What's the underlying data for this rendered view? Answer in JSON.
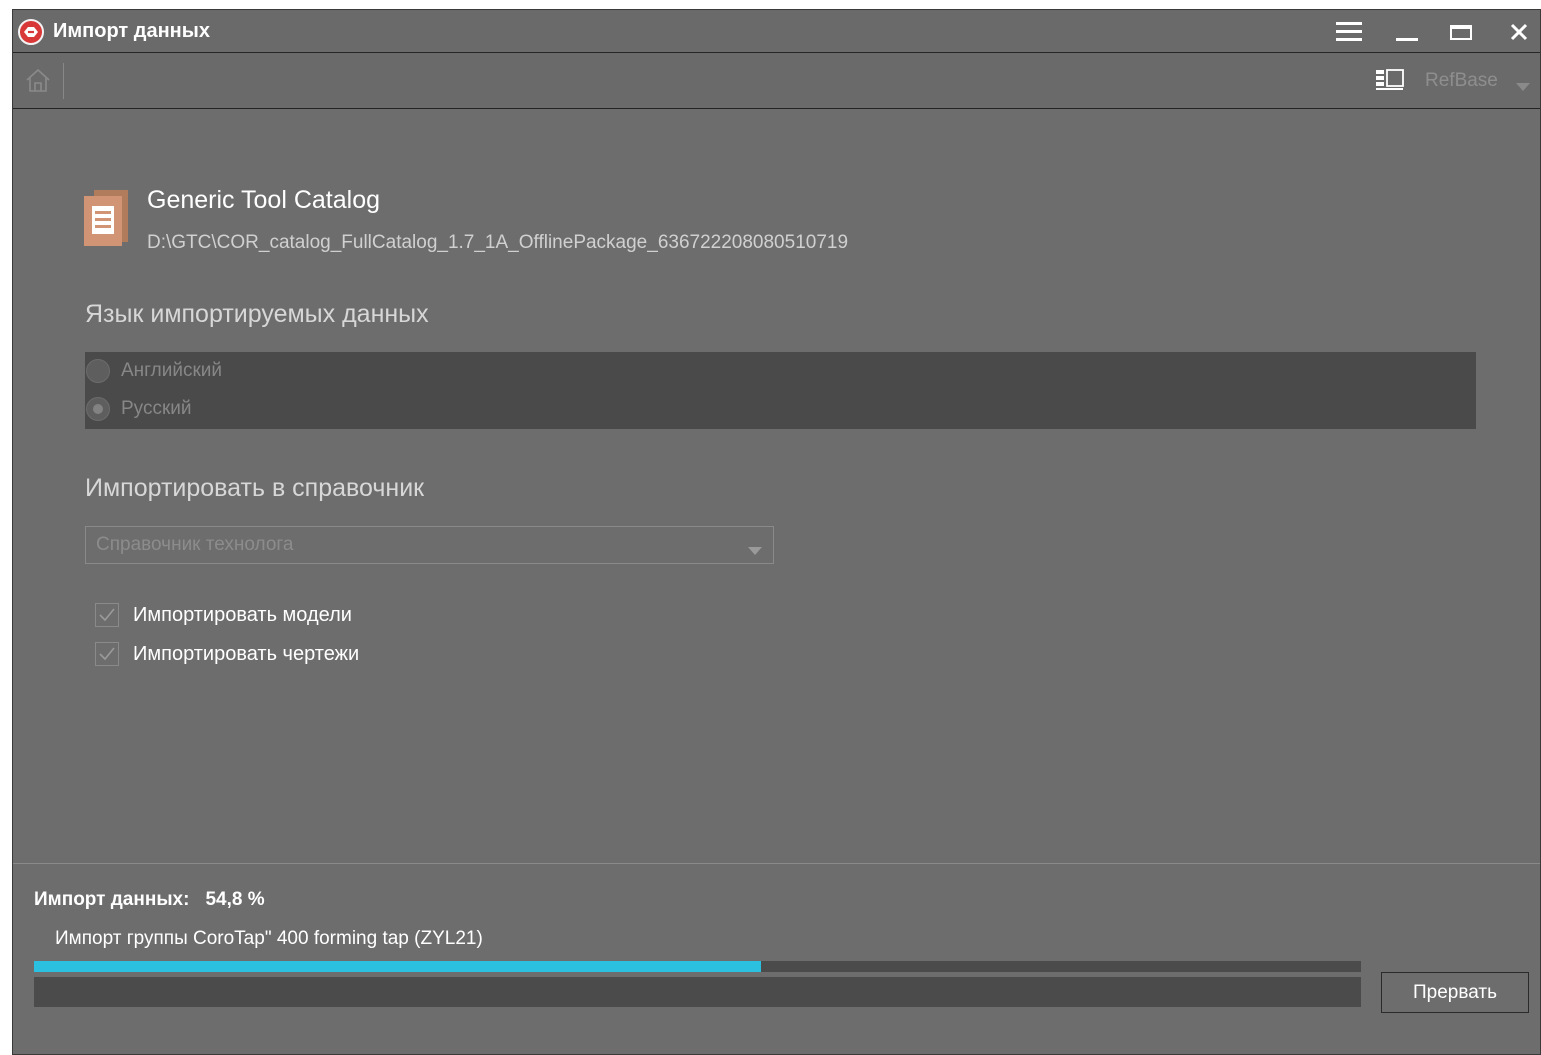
{
  "window": {
    "title": "Импорт данных"
  },
  "titlebar_icons": [
    "app-logo-icon",
    "hamburger-menu-icon",
    "minimize-icon",
    "maximize-icon",
    "close-icon"
  ],
  "toolbar": {
    "database_name": "RefBase"
  },
  "catalog": {
    "title": "Generic Tool Catalog",
    "path": "D:\\GTC\\COR_catalog_FullCatalog_1.7_1A_OfflinePackage_636722208080510719"
  },
  "language": {
    "title": "Язык импортируемых данных",
    "options": [
      {
        "label": "Английский",
        "selected": false
      },
      {
        "label": "Русский",
        "selected": true
      }
    ]
  },
  "target": {
    "title": "Импортировать в справочник",
    "selected": "Справочник технолога"
  },
  "options": {
    "import_models": {
      "label": "Импортировать модели",
      "checked": true
    },
    "import_drawings": {
      "label": "Импортировать чертежи",
      "checked": true
    }
  },
  "progress": {
    "label": "Импорт данных:",
    "percent_text": "54,8 %",
    "percent": 54.8,
    "status": "Импорт группы CoroTap\" 400 forming tap (ZYL21)",
    "abort_label": "Прервать"
  },
  "colors": {
    "window_bg": "#6d6d6d",
    "panel_bg": "#4a4a4a",
    "progress_fill": "#2cc0e0",
    "app_icon": "#d93838"
  }
}
